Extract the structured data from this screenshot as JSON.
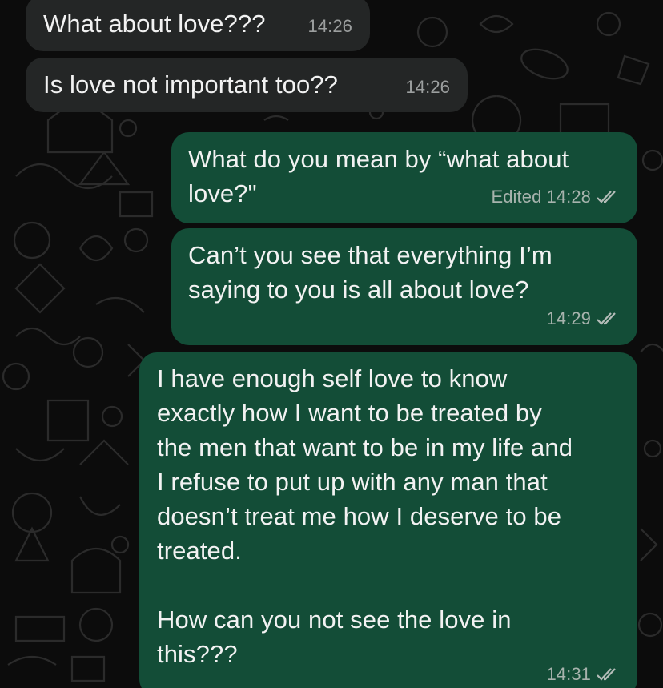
{
  "messages": [
    {
      "direction": "incoming",
      "text": "What about love???",
      "time": "14:26"
    },
    {
      "direction": "incoming",
      "text": "Is love not important too??",
      "time": "14:26"
    },
    {
      "direction": "outgoing",
      "text": "What do you mean by “what about\nlove?\"",
      "edited": "Edited",
      "time": "14:28",
      "status": "read-double-check-icon"
    },
    {
      "direction": "outgoing",
      "text": "Can’t you see that everything I’m\nsaying to you is all about love?",
      "time": "14:29",
      "status": "read-double-check-icon"
    },
    {
      "direction": "outgoing",
      "text": "I have enough self love to know\nexactly how I want to be treated by\nthe men that want to be in my life and\nI refuse to put up with any man that\ndoesn’t treat me how I deserve to be\ntreated.\n\nHow can you not see the love in\nthis???",
      "time": "14:31",
      "status": "read-double-check-icon"
    }
  ],
  "colors": {
    "background": "#0c0c0c",
    "incoming_bubble": "#242626",
    "outgoing_bubble": "#134d37",
    "text": "#f2f2f2",
    "timestamp": "#a7b3ad"
  }
}
